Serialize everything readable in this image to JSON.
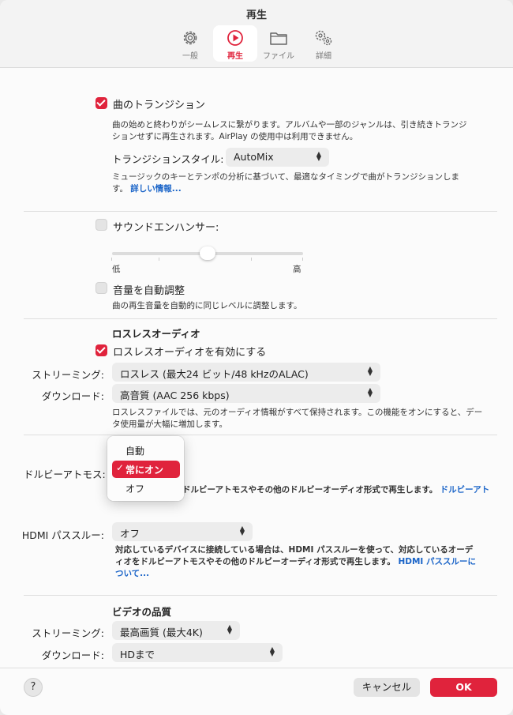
{
  "window": {
    "title": "再生"
  },
  "tabs": [
    {
      "label": "一般",
      "icon": "gear-icon"
    },
    {
      "label": "再生",
      "icon": "play-circle-icon",
      "active": true
    },
    {
      "label": "ファイル",
      "icon": "folder-icon"
    },
    {
      "label": "詳細",
      "icon": "gears-icon"
    }
  ],
  "crossfade": {
    "checkbox_label": "曲のトランジション",
    "description": "曲の始めと終わりがシームレスに繋がります。アルバムや一部のジャンルは、引き続きトランジションせずに再生されます。AirPlay の使用中は利用できません。",
    "style_label": "トランジションスタイル:",
    "style_value": "AutoMix",
    "automix_desc": "ミュージックのキーとテンポの分析に基づいて、最適なタイミングで曲がトランジションします。",
    "more_link": "詳しい情報..."
  },
  "sound_enhancer": {
    "label": "サウンドエンハンサー:",
    "low": "低",
    "high": "高",
    "level": 0.5
  },
  "sound_check": {
    "label": "音量を自動調整",
    "description": "曲の再生音量を自動的に同じレベルに調整します。"
  },
  "lossless": {
    "heading": "ロスレスオーディオ",
    "checkbox_label": "ロスレスオーディオを有効にする",
    "streaming_label": "ストリーミング:",
    "streaming_value": "ロスレス (最大24 ビット/48 kHzのALAC)",
    "download_label": "ダウンロード:",
    "download_value": "高音質 (AAC 256 kbps)",
    "description": "ロスレスファイルでは、元のオーディオ情報がすべて保持されます。この機能をオンにすると、データ使用量が大幅に増加します。"
  },
  "dolby": {
    "label": "ドルビーアトモス:",
    "description_visible": "ドルビーアトモスやその他のドルビーオーディオ形式で再生します。",
    "link_visible": "ドルビーアト",
    "menu": {
      "options": [
        "自動",
        "常にオン",
        "オフ"
      ],
      "selected": "常にオン"
    }
  },
  "hdmi": {
    "label": "HDMI パススルー:",
    "value": "オフ",
    "description": "対応しているデバイスに接続している場合は、HDMI パススルーを使って、対応しているオーディオをドルビーアトモスやその他のドルビーオーディオ形式で再生します。",
    "link": "HDMI パススルーについて..."
  },
  "video": {
    "heading": "ビデオの品質",
    "streaming_label": "ストリーミング:",
    "streaming_value": "最高画質 (最大4K)",
    "download_label": "ダウンロード:",
    "download_value": "HDまで"
  },
  "footer": {
    "help": "?",
    "cancel": "キャンセル",
    "ok": "OK"
  },
  "colors": {
    "accent": "#e0233c",
    "link": "#1a64c8"
  }
}
